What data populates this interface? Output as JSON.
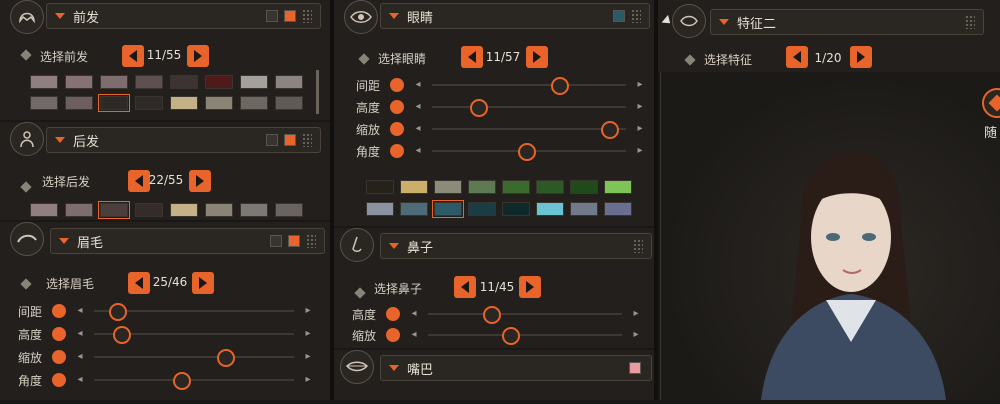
{
  "col1": {
    "front_hair": {
      "title": "前发",
      "select_label": "选择前发",
      "count": "11/55",
      "swatches": [
        "#8f7f80",
        "#867275",
        "#7d6d6f",
        "#5e4f51",
        "#3d3333",
        "#4e1a1a",
        "#a5a09a",
        "#8b8480",
        "#726a68",
        "#6d5f5f",
        "#2e2826",
        "#2f2a28",
        "#c4b188",
        "#8a8476",
        "#6c6861",
        "#5f5a55"
      ],
      "selected": 10,
      "color_a": "#3a3430",
      "color_b": "#e8642a"
    },
    "back_hair": {
      "title": "后发",
      "select_label": "选择后发",
      "count": "22/55",
      "swatches": [
        "#8f7f80",
        "#7d6d6f",
        "#4b3e3c",
        "#332c2a",
        "#c4b188",
        "#8a8476",
        "#7c7873",
        "#6a6460"
      ],
      "selected": 2
    },
    "eyebrow": {
      "title": "眉毛",
      "select_label": "选择眉毛",
      "count": "25/46",
      "sliders": [
        {
          "label": "间距",
          "value": 0.12
        },
        {
          "label": "高度",
          "value": 0.14
        },
        {
          "label": "缩放",
          "value": 0.66
        },
        {
          "label": "角度",
          "value": 0.44
        }
      ]
    }
  },
  "col2": {
    "eyes": {
      "title": "眼睛",
      "select_label": "选择眼睛",
      "count": "11/57",
      "swatch_color": "#2c5a66",
      "sliders": [
        {
          "label": "间距",
          "value": 0.66
        },
        {
          "label": "高度",
          "value": 0.24
        },
        {
          "label": "缩放",
          "value": 0.92
        },
        {
          "label": "角度",
          "value": 0.49
        }
      ],
      "swatches": [
        "#262119",
        "#cbae6a",
        "#8c8a7b",
        "#5d7a52",
        "#3a6b2c",
        "#2d5a24",
        "#1f4a1a",
        "#7fc456",
        "#8a93a0",
        "#4e6c78",
        "#2c5a66",
        "#1a3c45",
        "#102a2c",
        "#6cc3d6",
        "#707a8a",
        "#6a6f90"
      ],
      "selected": 10
    },
    "nose": {
      "title": "鼻子",
      "select_label": "选择鼻子",
      "count": "11/45",
      "sliders": [
        {
          "label": "高度",
          "value": 0.33
        },
        {
          "label": "缩放",
          "value": 0.43
        }
      ]
    },
    "mouth": {
      "title": "嘴巴",
      "swatch_color": "#e89aa0"
    }
  },
  "col3": {
    "feature2": {
      "title": "特征二",
      "select_label": "选择特征",
      "count": "1/20"
    },
    "random_label": "随"
  }
}
